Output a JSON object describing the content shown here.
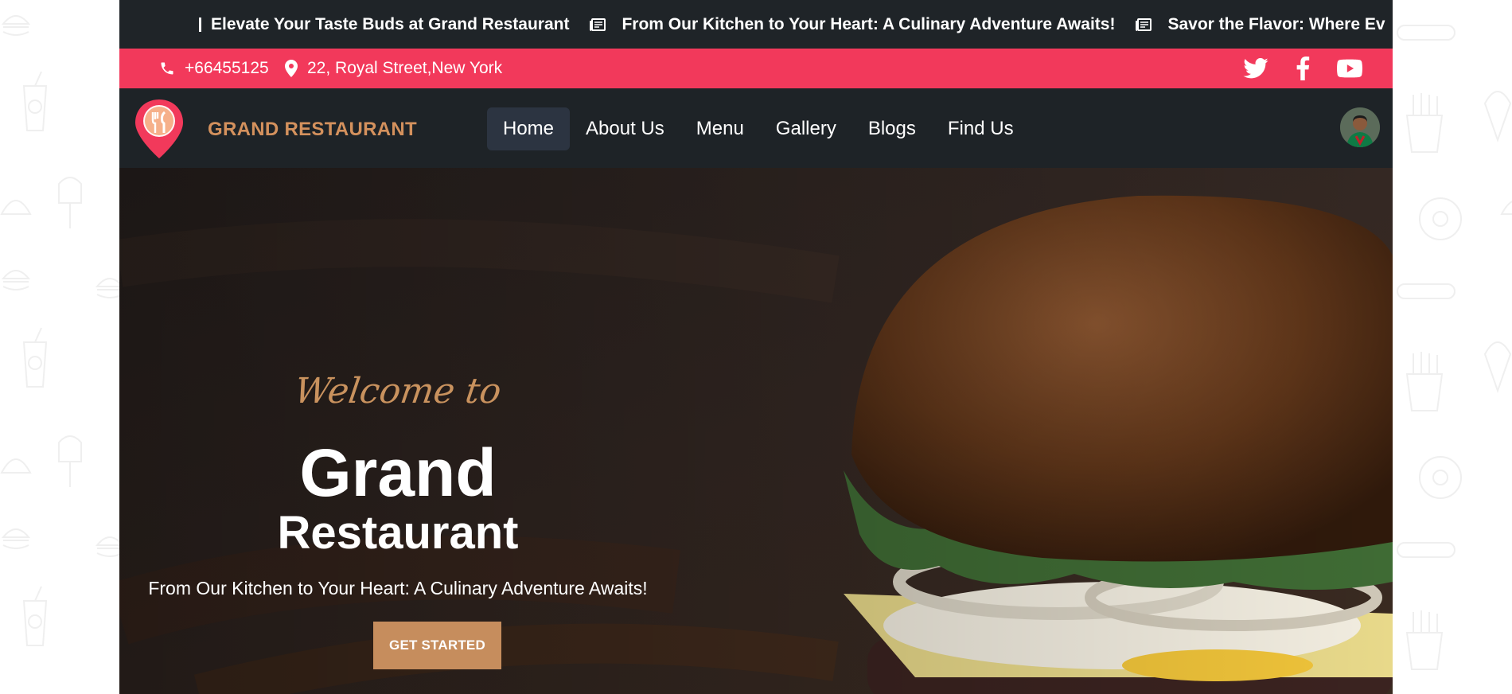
{
  "ticker": {
    "items": [
      "Elevate Your Taste Buds at Grand Restaurant",
      "From Our Kitchen to Your Heart: A Culinary Adventure Awaits!",
      "Savor the Flavor: Where Ev"
    ]
  },
  "contact": {
    "phone": "+66455125",
    "address": "22, Royal Street,New York",
    "socials": [
      "twitter-icon",
      "facebook-icon",
      "youtube-icon"
    ]
  },
  "navbar": {
    "brand": "GRAND RESTAURANT",
    "links": [
      "Home",
      "About Us",
      "Menu",
      "Gallery",
      "Blogs",
      "Find Us"
    ],
    "active": "Home"
  },
  "hero": {
    "welcome": "Welcome to",
    "title_line1": "Grand",
    "title_line2": "Restaurant",
    "tagline": "From Our Kitchen to Your Heart: A Culinary Adventure Awaits!",
    "cta_label": "GET STARTED"
  },
  "colors": {
    "accent_pink": "#f2395b",
    "brand_gold": "#d4915d",
    "dark": "#1e2327",
    "cta": "#c68d5d"
  }
}
